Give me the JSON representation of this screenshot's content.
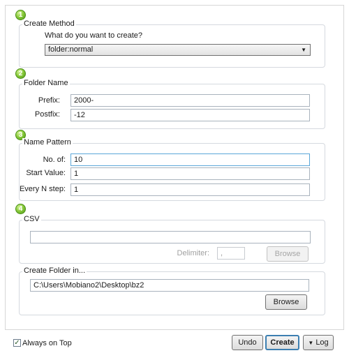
{
  "steps": [
    "1",
    "2",
    "3",
    "4"
  ],
  "create_method": {
    "title": "Create Method",
    "question": "What do you want to create?",
    "selected": "folder:normal"
  },
  "folder_name": {
    "title": "Folder Name",
    "prefix_label": "Prefix:",
    "prefix_value": "2000-",
    "postfix_label": "Postfix:",
    "postfix_value": "-12"
  },
  "name_pattern": {
    "title": "Name Pattern",
    "no_of_label": "No. of:",
    "no_of_value": "10",
    "start_label": "Start Value:",
    "start_value": "1",
    "step_label": "Every N step:",
    "step_value": "1"
  },
  "csv": {
    "title": "CSV",
    "path_value": "",
    "delimiter_label": "Delimiter:",
    "delimiter_value": ",",
    "browse_label": "Browse"
  },
  "create_folder_in": {
    "title": "Create Folder in...",
    "path_value": "C:\\Users\\Mobiano2\\Desktop\\bz2",
    "browse_label": "Browse"
  },
  "footer": {
    "always_on_top_label": "Always on Top",
    "always_on_top_checked": true,
    "undo_label": "Undo",
    "create_label": "Create",
    "log_label": "Log"
  },
  "colors": {
    "step_badge": "#6cb52a",
    "focus_border": "#5aa6d8",
    "default_button_border": "#3c7fb1"
  }
}
